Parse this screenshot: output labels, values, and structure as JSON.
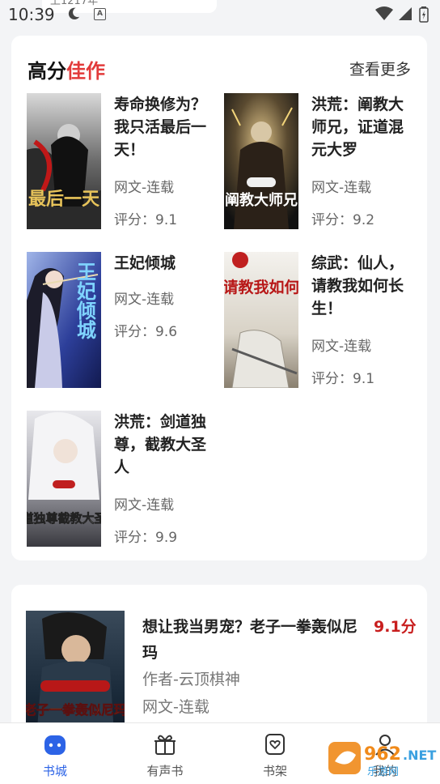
{
  "status": {
    "time": "10:39",
    "top_tab_text": "上1217年"
  },
  "section": {
    "title_part1": "高分",
    "title_part2": "佳作",
    "more": "查看更多",
    "accent_color": "#e23a3a"
  },
  "books": [
    {
      "title": "寿命换修为？我只活最后一天！",
      "tag": "网文-连载",
      "score": "评分：9.1",
      "cover_text": "最后一天"
    },
    {
      "title": "洪荒：阐教大师兄，证道混元大罗",
      "tag": "网文-连载",
      "score": "评分：9.2",
      "cover_text": "阐教大师兄"
    },
    {
      "title": "王妃倾城",
      "tag": "网文-连载",
      "score": "评分：9.6",
      "cover_text": "王妃倾城"
    },
    {
      "title": "综武：仙人，请教我如何长生！",
      "tag": "网文-连载",
      "score": "评分：9.1",
      "cover_text": "仙人请教我如何长生"
    },
    {
      "title": "洪荒：剑道独尊，截教大圣人",
      "tag": "网文-连载",
      "score": "评分：9.9",
      "cover_text": "剑道独尊截教大圣人"
    }
  ],
  "featured": {
    "title": "想让我当男宠？老子一拳轰似尼玛",
    "score": "9.1分",
    "author": "作者-云顶棋神",
    "tag": "网文-连载",
    "cover_text": "老子一拳轰似尼玛",
    "score_color": "#c81e1e"
  },
  "tabs": [
    {
      "label": "书城",
      "icon": "bookstore-icon",
      "active": true
    },
    {
      "label": "有声书",
      "icon": "gift-icon",
      "active": false
    },
    {
      "label": "书架",
      "icon": "bookshelf-heart-icon",
      "active": false
    },
    {
      "label": "我的",
      "icon": "profile-icon",
      "active": false
    }
  ],
  "watermark": "962.NET 乐游网",
  "active_color": "#2c63e6"
}
